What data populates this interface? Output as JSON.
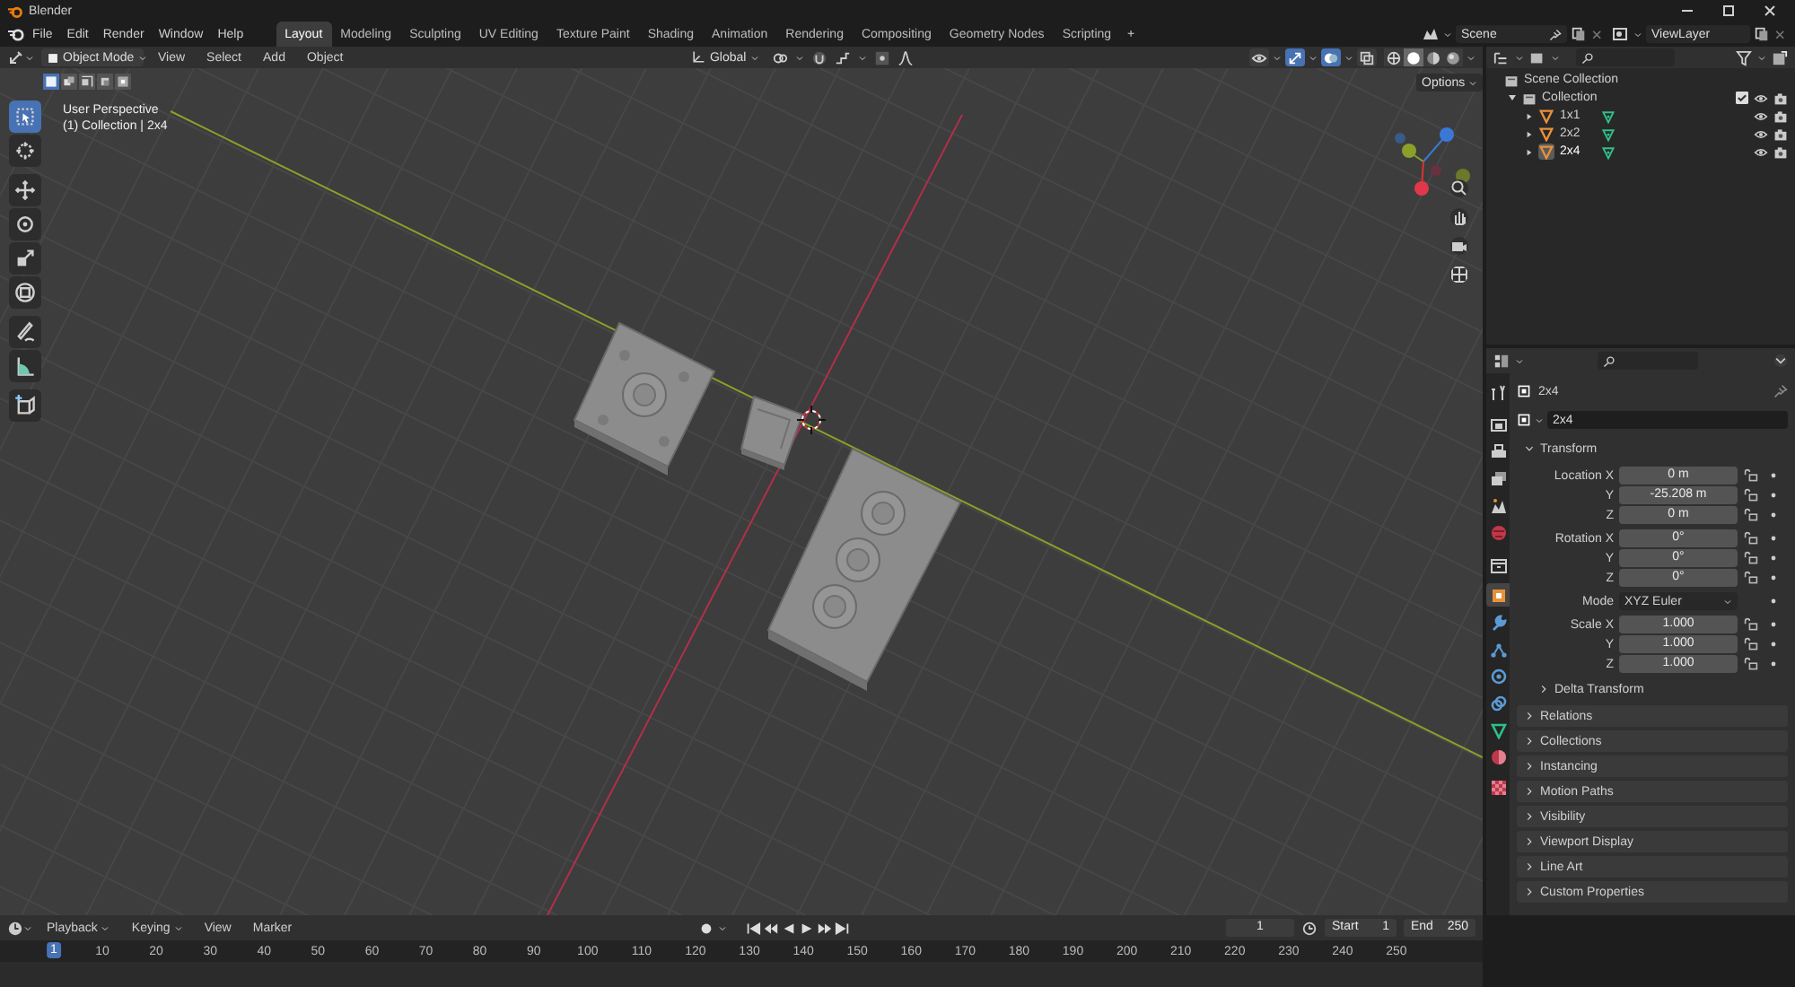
{
  "window": {
    "title": "Blender"
  },
  "menu": [
    "File",
    "Edit",
    "Render",
    "Window",
    "Help"
  ],
  "workspaces": [
    {
      "label": "Layout",
      "selected": true
    },
    {
      "label": "Modeling",
      "selected": false
    },
    {
      "label": "Sculpting",
      "selected": false
    },
    {
      "label": "UV Editing",
      "selected": false
    },
    {
      "label": "Texture Paint",
      "selected": false
    },
    {
      "label": "Shading",
      "selected": false
    },
    {
      "label": "Animation",
      "selected": false
    },
    {
      "label": "Rendering",
      "selected": false
    },
    {
      "label": "Compositing",
      "selected": false
    },
    {
      "label": "Geometry Nodes",
      "selected": false
    },
    {
      "label": "Scripting",
      "selected": false
    }
  ],
  "add_workspace": "+",
  "scene": {
    "value": "Scene"
  },
  "view_layer": {
    "value": "ViewLayer"
  },
  "viewport": {
    "mode": "Object Mode",
    "menus": [
      "View",
      "Select",
      "Add",
      "Object"
    ],
    "orientation": "Global",
    "toggles": [
      {
        "kind": "visibility",
        "on": false
      },
      {
        "kind": "gizmo",
        "on": true
      },
      {
        "kind": "overlay",
        "on": true
      },
      {
        "kind": "xray",
        "on": false
      }
    ],
    "shading": [
      {
        "kind": "wireframe",
        "selected": false
      },
      {
        "kind": "solid",
        "selected": true
      },
      {
        "kind": "material",
        "selected": false
      },
      {
        "kind": "rendered",
        "selected": false
      }
    ],
    "options": "Options",
    "select_modes": [
      {
        "selected": true
      },
      {
        "selected": false
      },
      {
        "selected": false
      },
      {
        "selected": false
      },
      {
        "selected": false
      }
    ],
    "info": [
      "User Perspective",
      "(1) Collection | 2x4"
    ],
    "tools": [
      {
        "kind": "select_box",
        "selected": true
      },
      {
        "kind": "cursor",
        "selected": false
      },
      {
        "kind": "move",
        "selected": false
      },
      {
        "kind": "rotate",
        "selected": false
      },
      {
        "kind": "scale",
        "selected": false
      },
      {
        "kind": "transform",
        "selected": false
      },
      {
        "kind": "annotate",
        "selected": false
      },
      {
        "kind": "measure",
        "selected": false
      },
      {
        "kind": "add_cube",
        "selected": false
      }
    ]
  },
  "outliner": {
    "root": "Scene Collection",
    "collections": [
      {
        "label": "Collection",
        "checked": true,
        "children": [
          {
            "label": "1x1",
            "selected": false
          },
          {
            "label": "2x2",
            "selected": false
          },
          {
            "label": "2x4",
            "selected": true
          }
        ]
      }
    ]
  },
  "properties": {
    "tabs": [
      {
        "kind": "tool",
        "selected": false
      },
      {
        "kind": "render",
        "selected": false
      },
      {
        "kind": "output",
        "selected": false
      },
      {
        "kind": "view_layer",
        "selected": false
      },
      {
        "kind": "scene",
        "selected": false
      },
      {
        "kind": "world",
        "selected": false
      },
      {
        "kind": "collection",
        "selected": false
      },
      {
        "kind": "object",
        "selected": true
      },
      {
        "kind": "modifiers",
        "selected": false
      },
      {
        "kind": "particles",
        "selected": false
      },
      {
        "kind": "physics",
        "selected": false
      },
      {
        "kind": "constraints",
        "selected": false
      },
      {
        "kind": "data",
        "selected": false
      },
      {
        "kind": "material",
        "selected": false
      },
      {
        "kind": "texture",
        "selected": false
      }
    ],
    "object_name": "2x4",
    "data_name": "2x4",
    "transform": {
      "title": "Transform",
      "expanded": true,
      "groups": [
        {
          "rows": [
            {
              "kind": "number",
              "label": "Location X",
              "value": "0 m"
            },
            {
              "kind": "number",
              "label": "Y",
              "value": "-25.208 m"
            },
            {
              "kind": "number",
              "label": "Z",
              "value": "0 m"
            }
          ]
        },
        {
          "rows": [
            {
              "kind": "number",
              "label": "Rotation X",
              "value": "0°"
            },
            {
              "kind": "number",
              "label": "Y",
              "value": "0°"
            },
            {
              "kind": "number",
              "label": "Z",
              "value": "0°"
            }
          ]
        },
        {
          "rows": [
            {
              "kind": "dropdown",
              "label": "Mode",
              "value": "XYZ Euler"
            }
          ]
        },
        {
          "rows": [
            {
              "kind": "number",
              "label": "Scale X",
              "value": "1.000"
            },
            {
              "kind": "number",
              "label": "Y",
              "value": "1.000"
            },
            {
              "kind": "number",
              "label": "Z",
              "value": "1.000"
            }
          ]
        }
      ],
      "subpanel": "Delta Transform"
    },
    "panels": [
      "Relations",
      "Collections",
      "Instancing",
      "Motion Paths",
      "Visibility",
      "Viewport Display",
      "Line Art",
      "Custom Properties"
    ]
  },
  "timeline": {
    "menus": [
      {
        "label": "Playback",
        "dropdown": true
      },
      {
        "label": "Keying",
        "dropdown": true
      },
      {
        "label": "View",
        "dropdown": false
      },
      {
        "label": "Marker",
        "dropdown": false
      }
    ],
    "current_frame": "1",
    "start_label": "Start",
    "start": "1",
    "end_label": "End",
    "end": "250",
    "playhead": "1",
    "ticks": [
      "10",
      "20",
      "30",
      "40",
      "50",
      "60",
      "70",
      "80",
      "90",
      "100",
      "110",
      "120",
      "130",
      "140",
      "150",
      "160",
      "170",
      "180",
      "190",
      "200",
      "210",
      "220",
      "230",
      "240",
      "250"
    ]
  }
}
